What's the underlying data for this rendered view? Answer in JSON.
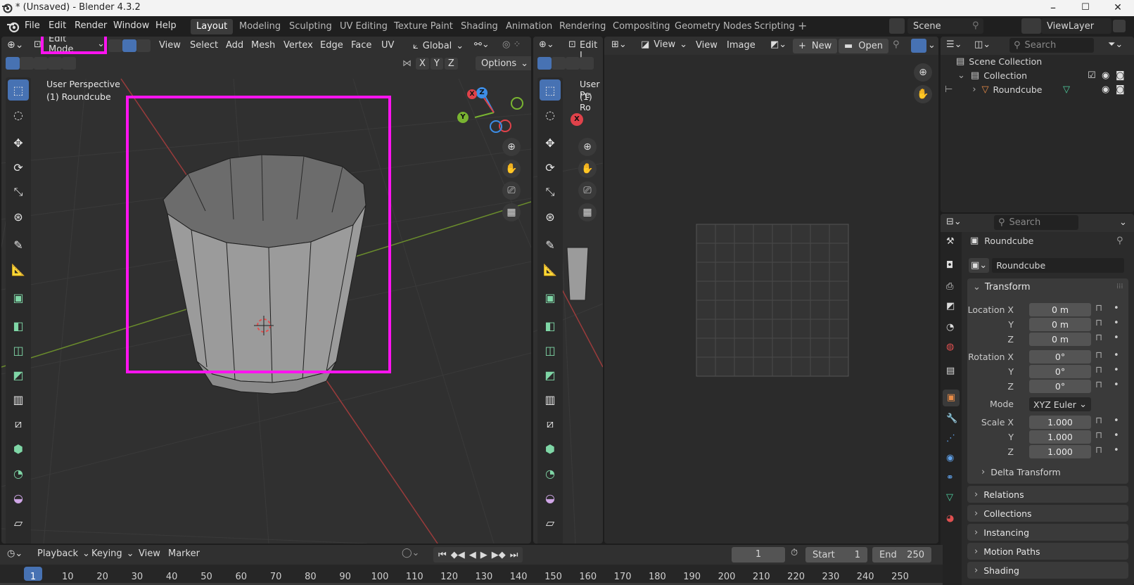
{
  "window": {
    "title": "* (Unsaved) - Blender 4.3.2",
    "minimize": "–",
    "maximize": "☐",
    "close": "✕"
  },
  "menu": {
    "items": [
      "File",
      "Edit",
      "Render",
      "Window",
      "Help"
    ]
  },
  "workspaces": {
    "tabs": [
      "Layout",
      "Modeling",
      "Sculpting",
      "UV Editing",
      "Texture Paint",
      "Shading",
      "Animation",
      "Rendering",
      "Compositing",
      "Geometry Nodes",
      "Scripting"
    ],
    "active": "Layout",
    "add": "+"
  },
  "scene": {
    "name": "Scene",
    "view_layer": "ViewLayer"
  },
  "viewport": {
    "mode": "Edit Mode",
    "menus": [
      "View",
      "Select",
      "Add",
      "Mesh",
      "Vertex",
      "Edge",
      "Face",
      "UV"
    ],
    "orientation": "Global",
    "axes": [
      "X",
      "Y",
      "Z"
    ],
    "options": "Options",
    "overlay_line1": "User Perspective",
    "overlay_line2": "(1) Roundcube",
    "gizmo": {
      "x": "X",
      "y": "Y",
      "z": "Z"
    }
  },
  "viewport2": {
    "mode_partial": "Edit I",
    "overlay_line1": "User Pe",
    "overlay_line2": "(1) Ro",
    "gizmo_x": "X"
  },
  "image_editor": {
    "view_label": "View",
    "menus": [
      "View",
      "Image"
    ],
    "new": "New",
    "open": "Open"
  },
  "outliner": {
    "search_placeholder": "Search",
    "scene_collection": "Scene Collection",
    "collection": "Collection",
    "object": "Roundcube"
  },
  "properties": {
    "search_placeholder": "Search",
    "object_name": "Roundcube",
    "name_field": "Roundcube",
    "transform": {
      "title": "Transform",
      "location_x_label": "Location X",
      "location_x": "0 m",
      "location_y_label": "Y",
      "location_y": "0 m",
      "location_z_label": "Z",
      "location_z": "0 m",
      "rotation_x_label": "Rotation X",
      "rotation_x": "0°",
      "rotation_y_label": "Y",
      "rotation_y": "0°",
      "rotation_z_label": "Z",
      "rotation_z": "0°",
      "mode_label": "Mode",
      "mode": "XYZ Euler",
      "scale_x_label": "Scale X",
      "scale_x": "1.000",
      "scale_y_label": "Y",
      "scale_y": "1.000",
      "scale_z_label": "Z",
      "scale_z": "1.000",
      "delta": "Delta Transform"
    },
    "panels": [
      "Relations",
      "Collections",
      "Instancing",
      "Motion Paths",
      "Shading"
    ]
  },
  "timeline": {
    "menus": [
      "Playback",
      "Keying",
      "View",
      "Marker"
    ],
    "current_frame": "1",
    "start_label": "Start",
    "start": "1",
    "end_label": "End",
    "end": "250",
    "ticks": [
      "1",
      "10",
      "20",
      "30",
      "40",
      "50",
      "60",
      "70",
      "80",
      "90",
      "100",
      "110",
      "120",
      "130",
      "140",
      "150",
      "160",
      "170",
      "180",
      "190",
      "200",
      "210",
      "220",
      "230",
      "240",
      "250"
    ]
  },
  "colors": {
    "highlight": "#ff13f0",
    "active_blue": "#4772b3",
    "axis_x": "#e0424a",
    "axis_y": "#79b431",
    "axis_z": "#3d8de6"
  }
}
